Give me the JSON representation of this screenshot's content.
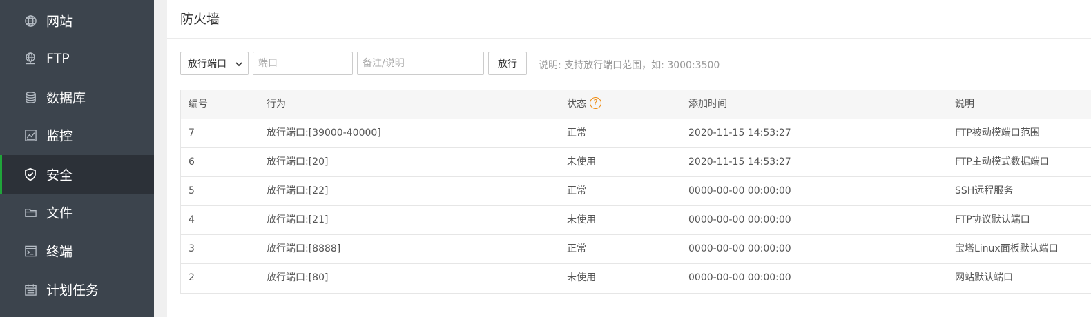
{
  "sidebar": {
    "items": [
      {
        "label": "网站",
        "icon": "globe-icon",
        "active": false
      },
      {
        "label": "FTP",
        "icon": "ftp-icon",
        "active": false
      },
      {
        "label": "数据库",
        "icon": "database-icon",
        "active": false
      },
      {
        "label": "监控",
        "icon": "monitor-chart-icon",
        "active": false
      },
      {
        "label": "安全",
        "icon": "shield-check-icon",
        "active": true
      },
      {
        "label": "文件",
        "icon": "folder-icon",
        "active": false
      },
      {
        "label": "终端",
        "icon": "terminal-icon",
        "active": false
      },
      {
        "label": "计划任务",
        "icon": "calendar-icon",
        "active": false
      }
    ]
  },
  "page": {
    "title": "防火墙"
  },
  "toolbar": {
    "action_select_value": "放行端口",
    "port_placeholder": "端口",
    "note_placeholder": "备注/说明",
    "allow_label": "放行",
    "hint": "说明: 支持放行端口范围，如: 3000:3500"
  },
  "table": {
    "headers": [
      "编号",
      "行为",
      "状态",
      "添加时间",
      "说明"
    ],
    "status_help": "?",
    "rows": [
      [
        "7",
        "放行端口:[39000-40000]",
        "正常",
        "2020-11-15 14:53:27",
        "FTP被动模端口范围"
      ],
      [
        "6",
        "放行端口:[20]",
        "未使用",
        "2020-11-15 14:53:27",
        "FTP主动模式数据端口"
      ],
      [
        "5",
        "放行端口:[22]",
        "正常",
        "0000-00-00 00:00:00",
        "SSH远程服务"
      ],
      [
        "4",
        "放行端口:[21]",
        "未使用",
        "0000-00-00 00:00:00",
        "FTP协议默认端口"
      ],
      [
        "3",
        "放行端口:[8888]",
        "正常",
        "0000-00-00 00:00:00",
        "宝塔Linux面板默认端口"
      ],
      [
        "2",
        "放行端口:[80]",
        "未使用",
        "0000-00-00 00:00:00",
        "网站默认端口"
      ]
    ]
  },
  "colors": {
    "sidebar_bg": "#3c444d",
    "sidebar_active_bg": "#2c3138",
    "accent_green": "#20a53a",
    "help_orange": "#ef8c12"
  }
}
